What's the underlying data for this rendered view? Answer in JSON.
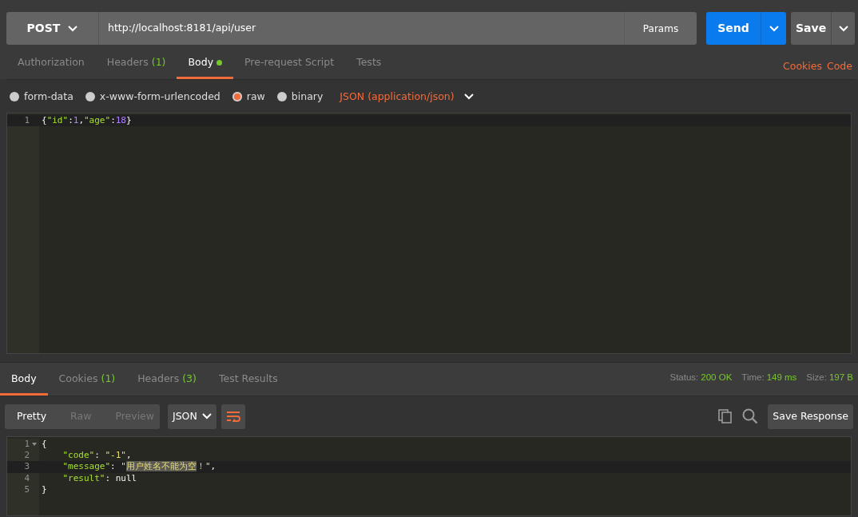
{
  "request": {
    "method": "POST",
    "url": "http://localhost:8181/api/user",
    "params_label": "Params",
    "send_label": "Send",
    "save_label": "Save"
  },
  "request_tabs": [
    {
      "label": "Authorization",
      "selected": false
    },
    {
      "label": "Headers",
      "count": "(1)",
      "selected": false
    },
    {
      "label": "Body",
      "selected": true,
      "dot": true
    },
    {
      "label": "Pre-request Script",
      "selected": false
    },
    {
      "label": "Tests",
      "selected": false
    }
  ],
  "request_links": [
    "Cookies",
    "Code"
  ],
  "body_modes": [
    {
      "label": "form-data",
      "selected": false
    },
    {
      "label": "x-www-form-urlencoded",
      "selected": false
    },
    {
      "label": "raw",
      "selected": true
    },
    {
      "label": "binary",
      "selected": false
    }
  ],
  "content_type": "JSON (application/json)",
  "request_editor": {
    "lines": [
      {
        "number": "1",
        "current": true,
        "tokens": [
          {
            "kind": "punct",
            "text": "{"
          },
          {
            "kind": "key",
            "text": "\"id\""
          },
          {
            "kind": "punct",
            "text": ":"
          },
          {
            "kind": "number",
            "text": "1"
          },
          {
            "kind": "punct",
            "text": ","
          },
          {
            "kind": "key",
            "text": "\"age\""
          },
          {
            "kind": "punct",
            "text": ":"
          },
          {
            "kind": "number",
            "text": "18"
          },
          {
            "kind": "punct",
            "text": "}"
          }
        ]
      }
    ]
  },
  "response_tabs": [
    {
      "label": "Body",
      "selected": true
    },
    {
      "label": "Cookies",
      "count": "(1)",
      "selected": false
    },
    {
      "label": "Headers",
      "count": "(3)",
      "selected": false
    },
    {
      "label": "Test Results",
      "selected": false
    }
  ],
  "response_meta": [
    {
      "label": "Status:",
      "value": "200 OK"
    },
    {
      "label": "Time:",
      "value": "149 ms"
    },
    {
      "label": "Size:",
      "value": "197 B"
    }
  ],
  "view_modes": [
    {
      "label": "Pretty",
      "selected": true
    },
    {
      "label": "Raw",
      "selected": false
    },
    {
      "label": "Preview",
      "selected": false
    }
  ],
  "format": "JSON",
  "save_response_label": "Save Response",
  "response_editor": {
    "lines": [
      {
        "number": "1",
        "current": false,
        "foldable": true,
        "tokens": [
          {
            "kind": "punct",
            "text": "{"
          }
        ]
      },
      {
        "number": "2",
        "current": false,
        "tokens": [
          {
            "kind": "key",
            "text": "    \"code\""
          },
          {
            "kind": "punct",
            "text": ": "
          },
          {
            "kind": "string",
            "text": "\"-1\""
          },
          {
            "kind": "punct",
            "text": ","
          }
        ]
      },
      {
        "number": "3",
        "current": true,
        "tokens": [
          {
            "kind": "key",
            "text": "    \"message\""
          },
          {
            "kind": "punct",
            "text": ": "
          },
          {
            "kind": "string",
            "text": "\""
          },
          {
            "kind": "highlight",
            "text": "用户姓名不能为空"
          },
          {
            "kind": "string",
            "text": "！\""
          },
          {
            "kind": "punct",
            "text": ","
          }
        ]
      },
      {
        "number": "4",
        "current": false,
        "tokens": [
          {
            "kind": "key",
            "text": "    \"result\""
          },
          {
            "kind": "punct",
            "text": ": "
          },
          {
            "kind": "literal",
            "text": "null"
          }
        ]
      },
      {
        "number": "5",
        "current": false,
        "tokens": [
          {
            "kind": "punct",
            "text": "}"
          }
        ]
      }
    ]
  }
}
